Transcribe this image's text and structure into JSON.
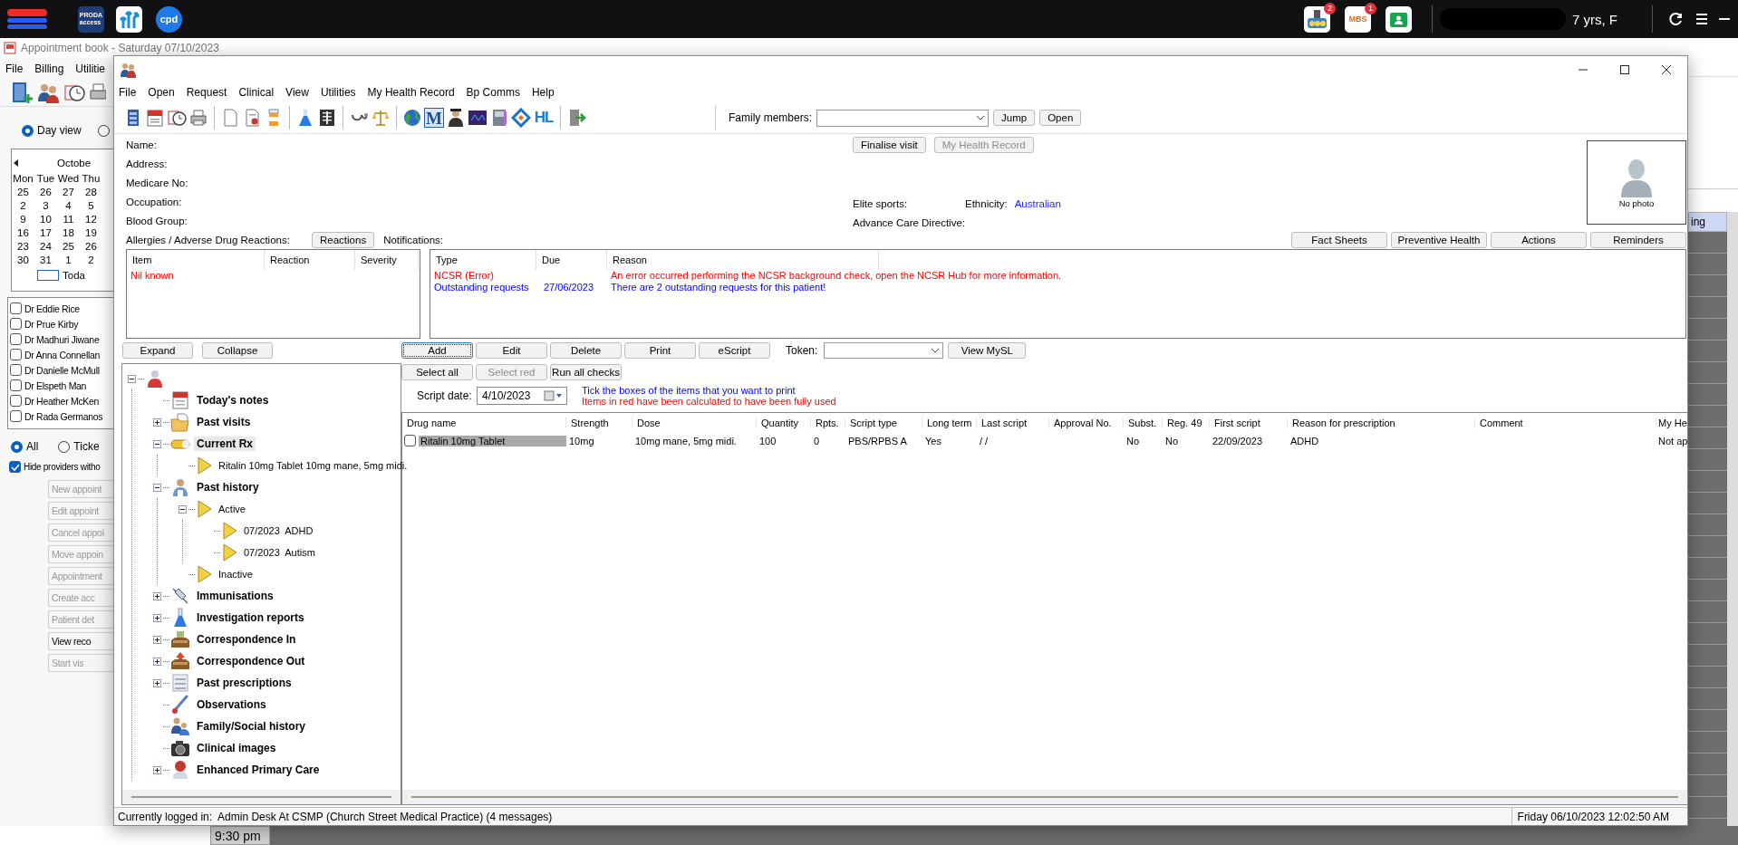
{
  "top_bar": {
    "proda_tile": {
      "line_1": "PRODA",
      "line_2": "access"
    },
    "cpd_tile": "cpd",
    "alerts": [
      {
        "badge": "2"
      },
      {
        "label": "MBS",
        "badge": "1"
      }
    ],
    "patient_summary": "7 yrs, F"
  },
  "appointment_book": {
    "title": "Appointment book - Saturday 07/10/2023",
    "menu": [
      "File",
      "Billing",
      "Utilitie"
    ],
    "view_options": [
      {
        "label": "Day view",
        "selected": true
      },
      {
        "selected": false
      }
    ],
    "calendar": {
      "month": "Octobe",
      "weekdays": [
        "Mon",
        "Tue",
        "Wed",
        "Thu"
      ],
      "weeks": [
        [
          "25",
          "26",
          "27",
          "28"
        ],
        [
          "2",
          "3",
          "4",
          "5"
        ],
        [
          "9",
          "10",
          "11",
          "12"
        ],
        [
          "16",
          "17",
          "18",
          "19"
        ],
        [
          "23",
          "24",
          "25",
          "26"
        ],
        [
          "30",
          "31",
          "1",
          "2"
        ]
      ],
      "today_label": "Toda"
    },
    "providers": [
      {
        "name": "Dr Eddie Rice",
        "checked": false
      },
      {
        "name": "Dr Prue Kirby",
        "checked": false
      },
      {
        "name": "Dr Madhuri Jiwane",
        "checked": false
      },
      {
        "name": "Dr Anna Connellan",
        "checked": false
      },
      {
        "name": "Dr Danielle McMull",
        "checked": false
      },
      {
        "name": "Dr Elspeth Man",
        "checked": false
      },
      {
        "name": "Dr Heather McKen",
        "checked": false
      },
      {
        "name": "Dr Rada Germanos",
        "checked": false
      }
    ],
    "provider_filter": [
      {
        "label": "All",
        "selected": true
      },
      {
        "label": "Ticke",
        "selected": false
      }
    ],
    "hide_providers": {
      "label": "Hide providers witho",
      "checked": true
    },
    "actions": [
      {
        "label": "New appoint",
        "disabled": true
      },
      {
        "label": "Edit appoint",
        "disabled": true
      },
      {
        "label": "Cancel appoi",
        "disabled": true
      },
      {
        "label": "Move appoin",
        "disabled": true
      },
      {
        "label": "Appointment",
        "disabled": true
      },
      {
        "label": "Create acc",
        "disabled": true
      },
      {
        "label": "Patient det",
        "disabled": true
      },
      {
        "label": "View reco",
        "disabled": false
      },
      {
        "label": "Start vis",
        "disabled": true
      }
    ],
    "grid": {
      "column_header": "ing",
      "time": "9:30 pm"
    }
  },
  "patient_window": {
    "menu": [
      "File",
      "Open",
      "Request",
      "Clinical",
      "View",
      "Utilities",
      "My Health Record",
      "Bp Comms",
      "Help"
    ],
    "toolbar": {
      "icon_letters": [
        "M",
        "HL"
      ]
    },
    "family_members": {
      "label": "Family members:",
      "buttons": [
        "Jump",
        "Open"
      ]
    },
    "details": [
      "Name:",
      "Address:",
      "Medicare No:",
      "Occupation:",
      "Blood Group:"
    ],
    "visit_buttons": [
      {
        "label": "Finalise visit",
        "disabled": false
      },
      {
        "label": "My Health Record",
        "disabled": true
      }
    ],
    "elite_sports": {
      "label": "Elite sports:"
    },
    "ethnicity": {
      "label": "Ethnicity:",
      "value": "Australian"
    },
    "advance_care_directive": {
      "label": "Advance Care Directive:"
    },
    "photo": {
      "caption": "No photo"
    },
    "allergies": {
      "title": "Allergies / Adverse Drug Reactions:",
      "button": "Reactions",
      "columns": [
        "Item",
        "Reaction",
        "Severity"
      ],
      "rows": [
        {
          "item": "Nil known",
          "color": "#ff0000"
        }
      ]
    },
    "notifications": {
      "title": "Notifications:",
      "buttons": [
        "Fact Sheets",
        "Preventive Health",
        "Actions",
        "Reminders"
      ],
      "columns": [
        "Type",
        "Due",
        "Reason"
      ],
      "rows": [
        {
          "type": "NCSR (Error)",
          "reason": "An error occurred performing the NCSR background check, open the NCSR Hub for more information.",
          "color": "#ff0000"
        },
        {
          "type": "Outstanding requests",
          "due": "27/06/2023",
          "reason": "There are 2 outstanding requests for this patient!",
          "color": "#0000ff"
        }
      ]
    },
    "tree": {
      "buttons": [
        "Expand",
        "Collapse"
      ],
      "root": {
        "kind": "group",
        "expanded": true,
        "children": [
          {
            "label": "Today's notes",
            "kind": "leaf",
            "selected": false
          },
          {
            "label": "Past visits",
            "kind": "group",
            "expanded": false,
            "selected": false
          },
          {
            "label": "Current Rx",
            "kind": "group",
            "expanded": true,
            "selected": true,
            "children": [
              {
                "label": "Ritalin 10mg Tablet 10mg mane, 5mg midi.",
                "kind": "leaf",
                "selected": false
              }
            ]
          },
          {
            "label": "Past history",
            "kind": "group",
            "expanded": true,
            "selected": false,
            "children": [
              {
                "label": "Active",
                "kind": "group",
                "expanded": true,
                "selected": false,
                "children": [
                  {
                    "label": "07/2023  ADHD",
                    "kind": "leaf",
                    "selected": false
                  },
                  {
                    "label": "07/2023  Autism",
                    "kind": "leaf",
                    "selected": false
                  }
                ]
              },
              {
                "label": "Inactive",
                "kind": "leaf",
                "selected": false
              }
            ]
          },
          {
            "label": "Immunisations",
            "kind": "group",
            "expanded": false,
            "selected": false
          },
          {
            "label": "Investigation reports",
            "kind": "group",
            "expanded": false,
            "selected": false
          },
          {
            "label": "Correspondence In",
            "kind": "group",
            "expanded": false,
            "selected": false
          },
          {
            "label": "Correspondence Out",
            "kind": "group",
            "expanded": false,
            "selected": false
          },
          {
            "label": "Past prescriptions",
            "kind": "group",
            "expanded": false,
            "selected": false
          },
          {
            "label": "Observations",
            "kind": "leaf",
            "selected": false
          },
          {
            "label": "Family/Social history",
            "kind": "leaf",
            "selected": false
          },
          {
            "label": "Clinical images",
            "kind": "leaf",
            "selected": false
          },
          {
            "label": "Enhanced Primary Care",
            "kind": "group",
            "expanded": false,
            "selected": false
          }
        ]
      }
    },
    "prescriptions": {
      "buttons": [
        {
          "label": "Add",
          "disabled": false,
          "focused": true
        },
        {
          "label": "Edit",
          "disabled": false,
          "focused": false
        },
        {
          "label": "Delete",
          "disabled": false,
          "focused": false
        },
        {
          "label": "Print",
          "disabled": false,
          "focused": false
        },
        {
          "label": "eScript",
          "disabled": false,
          "focused": false
        }
      ],
      "token_label": "Token:",
      "view_button": "View MySL",
      "select_buttons": [
        {
          "label": "Select all",
          "disabled": false
        },
        {
          "label": "Select red",
          "disabled": true
        },
        {
          "label": "Run all checks",
          "disabled": false
        }
      ],
      "script_date": {
        "label": "Script date:",
        "value": "4/10/2023"
      },
      "notes": [
        {
          "text": "Tick the boxes of the items that you want to print",
          "color": "#0000ff"
        },
        {
          "text": "Items in red have been calculated to have been fully used",
          "color": "#ff0000"
        }
      ],
      "columns": [
        "Drug name",
        "Strength",
        "Dose",
        "Quantity",
        "Rpts.",
        "Script type",
        "Long term",
        "Last script",
        "Approval No.",
        "Subst.",
        "Reg. 49",
        "First script",
        "Reason for prescription",
        "Comment",
        "My He"
      ],
      "rows": [
        {
          "checked": false,
          "selected": true,
          "cells": [
            "Ritalin 10mg Tablet",
            "10mg",
            "10mg mane, 5mg midi.",
            "100",
            "0",
            "PBS/RPBS A",
            "Yes",
            "/ /",
            null,
            "No",
            "No",
            "22/09/2023",
            "ADHD",
            null,
            "Not ap"
          ]
        }
      ]
    },
    "status_bar": {
      "logged_in": "Currently logged in:  Admin Desk At CSMP (Church Street Medical Practice) (4 messages)",
      "datetime": "Friday 06/10/2023 12:02:50 AM"
    }
  }
}
